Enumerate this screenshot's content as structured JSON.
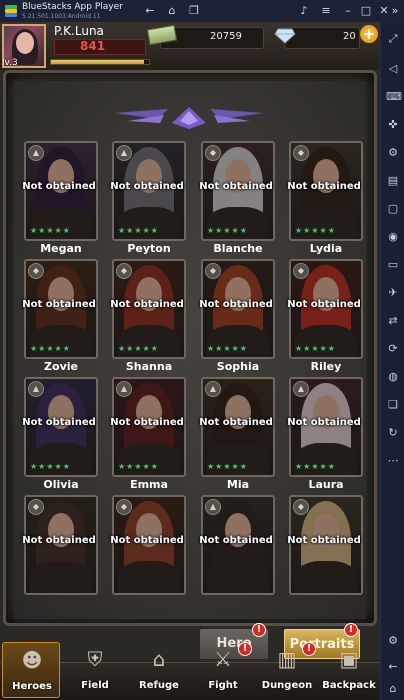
{
  "app": {
    "title": "BlueStacks App Player",
    "version": "5.21.501.1003  Android 11"
  },
  "player": {
    "name": "P.K.Luna",
    "level": "lv.3",
    "power": "841",
    "xp_progress": 0.95
  },
  "resources": {
    "cash": "20759",
    "gems": "20"
  },
  "heroes": [
    {
      "name": "Megan",
      "status": "Not obtained",
      "stars": "★★★★★",
      "badge": "▲",
      "hair": "#2b1838",
      "bg": "#3b2a44"
    },
    {
      "name": "Peyton",
      "status": "Not obtained",
      "stars": "★★★★★",
      "badge": "▲",
      "hair": "#6b6a72",
      "bg": "#2c2a33"
    },
    {
      "name": "Blanche",
      "status": "Not obtained",
      "stars": "★★★★★",
      "badge": "◆",
      "hair": "#c9c7c8",
      "bg": "#3a2a2a"
    },
    {
      "name": "Lydia",
      "status": "Not obtained",
      "stars": "★★★★★",
      "badge": "◆",
      "hair": "#2b1d16",
      "bg": "#3a3228"
    },
    {
      "name": "Zovie",
      "status": "Not obtained",
      "stars": "★★★★★",
      "badge": "◆",
      "hair": "#5a2a1a",
      "bg": "#3a2618"
    },
    {
      "name": "Shanna",
      "status": "Not obtained",
      "stars": "★★★★★",
      "badge": "◆",
      "hair": "#8a2a1c",
      "bg": "#3a2016"
    },
    {
      "name": "Sophia",
      "status": "Not obtained",
      "stars": "★★★★★",
      "badge": "◆",
      "hair": "#9c3a1e",
      "bg": "#2e1f1a"
    },
    {
      "name": "Riley",
      "status": "Not obtained",
      "stars": "★★★★★",
      "badge": "◆",
      "hair": "#b42a1e",
      "bg": "#3a1a16"
    },
    {
      "name": "Olivia",
      "status": "Not obtained",
      "stars": "★★★★★",
      "badge": "▲",
      "hair": "#3a2a5a",
      "bg": "#2c2640"
    },
    {
      "name": "Emma",
      "status": "Not obtained",
      "stars": "★★★★★",
      "badge": "▲",
      "hair": "#5a1a1a",
      "bg": "#3a1a1c"
    },
    {
      "name": "Mia",
      "status": "Not obtained",
      "stars": "★★★★★",
      "badge": "▲",
      "hair": "#2a1a14",
      "bg": "#3a2a20"
    },
    {
      "name": "Laura",
      "status": "Not obtained",
      "stars": "★★★★★",
      "badge": "▲",
      "hair": "#d8c6c8",
      "bg": "#3a2026"
    },
    {
      "name": "",
      "status": "Not obtained",
      "stars": "",
      "badge": "◆",
      "hair": "#3a2a22",
      "bg": "#2e2722"
    },
    {
      "name": "",
      "status": "Not obtained",
      "stars": "",
      "badge": "◆",
      "hair": "#8a3a22",
      "bg": "#3a2018"
    },
    {
      "name": "",
      "status": "Not obtained",
      "stars": "",
      "badge": "▲",
      "hair": "#2a2220",
      "bg": "#2c2a2a"
    },
    {
      "name": "",
      "status": "Not obtained",
      "stars": "",
      "badge": "◆",
      "hair": "#c9a978",
      "bg": "#3a3228"
    }
  ],
  "mode_tabs": {
    "hero_label": "Hero",
    "portraits_label": "Portraits",
    "alert": "!"
  },
  "nav": [
    {
      "label": "Heroes",
      "icon": "heroes-icon",
      "glyph": "☻",
      "alert": false
    },
    {
      "label": "Field",
      "icon": "field-icon",
      "glyph": "⛨",
      "alert": false
    },
    {
      "label": "Refuge",
      "icon": "refuge-icon",
      "glyph": "⌂",
      "alert": false
    },
    {
      "label": "Fight",
      "icon": "fight-icon",
      "glyph": "⚔",
      "alert": true
    },
    {
      "label": "Dungeon",
      "icon": "dungeon-icon",
      "glyph": "▥",
      "alert": true
    },
    {
      "label": "Backpack",
      "icon": "backpack-icon",
      "glyph": "▣",
      "alert": false
    }
  ],
  "colors": {
    "star_green": "#4fc36a",
    "alert_red": "#d62a22",
    "active_gold": "#d9b45a",
    "power_red": "#e6554a"
  }
}
